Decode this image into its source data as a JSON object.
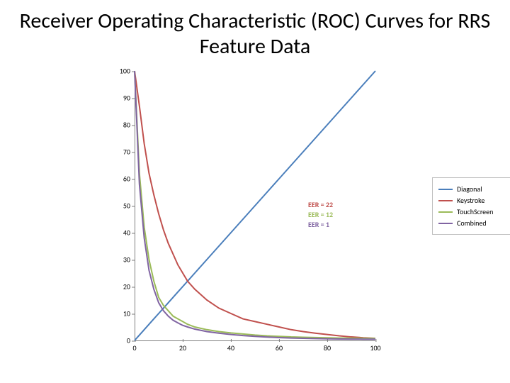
{
  "title": "Receiver Operating Characteristic (ROC) Curves for RRS Feature Data",
  "legend": {
    "diagonal": "Diagonal",
    "keystroke": "Keystroke",
    "touchscreen": "TouchScreen",
    "combined": "Combined"
  },
  "eer": {
    "keystroke": "EER = 22",
    "touchscreen": "EER = 12",
    "combined": "EER =  1"
  },
  "axis": {
    "xticks": [
      "0",
      "20",
      "40",
      "60",
      "80",
      "100"
    ],
    "yticks": [
      "0",
      "10",
      "20",
      "30",
      "40",
      "50",
      "60",
      "70",
      "80",
      "90",
      "100"
    ]
  },
  "colors": {
    "diagonal": "#4a7ebb",
    "keystroke": "#c0504d",
    "touchscreen": "#9bbb59",
    "combined": "#8064a2",
    "border": "#bfbfbf"
  },
  "chart_data": {
    "type": "line",
    "title": "Receiver Operating Characteristic (ROC) Curves for RRS Feature Data",
    "xlabel": "",
    "ylabel": "",
    "xlim": [
      0,
      100
    ],
    "ylim": [
      0,
      100
    ],
    "x": [
      0,
      2,
      4,
      6,
      8,
      10,
      12,
      14,
      16,
      18,
      20,
      22,
      25,
      30,
      35,
      40,
      45,
      50,
      55,
      60,
      65,
      70,
      75,
      80,
      85,
      90,
      95,
      100
    ],
    "series": [
      {
        "name": "Diagonal",
        "color": "#4a7ebb",
        "values": [
          0,
          2,
          4,
          6,
          8,
          10,
          12,
          14,
          16,
          18,
          20,
          22,
          25,
          30,
          35,
          40,
          45,
          50,
          55,
          60,
          65,
          70,
          75,
          80,
          85,
          90,
          95,
          100
        ]
      },
      {
        "name": "Keystroke",
        "color": "#c0504d",
        "eer": 22,
        "values": [
          100,
          87,
          73,
          62,
          54,
          47,
          41,
          36,
          32,
          28,
          25,
          22,
          19,
          15,
          12,
          10,
          8,
          7,
          6,
          5,
          4,
          3.3,
          2.7,
          2.2,
          1.7,
          1.3,
          1,
          0.8
        ]
      },
      {
        "name": "TouchScreen",
        "color": "#9bbb59",
        "eer": 12,
        "values": [
          100,
          62,
          42,
          30,
          22,
          16,
          13,
          11,
          9,
          8,
          7,
          6,
          5,
          4,
          3.3,
          2.8,
          2.4,
          2,
          1.7,
          1.5,
          1.3,
          1.2,
          1.1,
          1,
          0.9,
          0.85,
          0.8,
          0.75
        ]
      },
      {
        "name": "Combined",
        "color": "#8064a2",
        "eer": 1,
        "values": [
          100,
          58,
          38,
          26,
          19,
          14,
          11,
          9,
          7.5,
          6.5,
          5.6,
          5,
          4.2,
          3.3,
          2.7,
          2.2,
          1.8,
          1.5,
          1.25,
          1.05,
          0.9,
          0.78,
          0.68,
          0.6,
          0.54,
          0.5,
          0.47,
          0.45
        ]
      }
    ]
  }
}
